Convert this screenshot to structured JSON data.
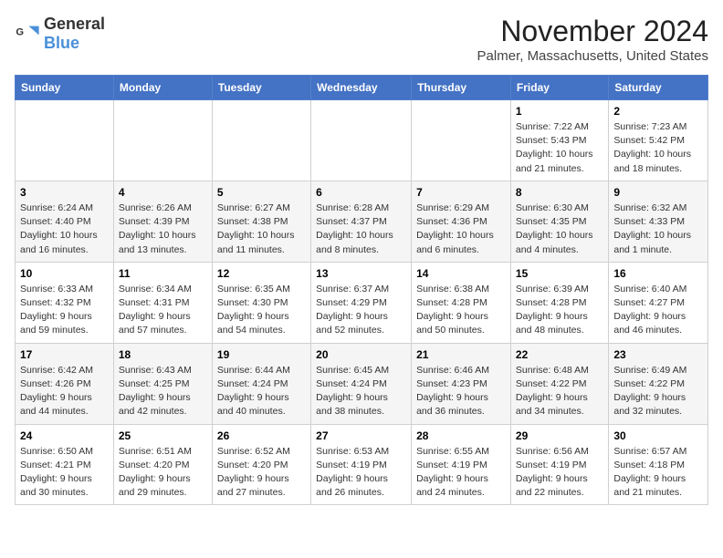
{
  "logo": {
    "general": "General",
    "blue": "Blue"
  },
  "title": "November 2024",
  "location": "Palmer, Massachusetts, United States",
  "days_of_week": [
    "Sunday",
    "Monday",
    "Tuesday",
    "Wednesday",
    "Thursday",
    "Friday",
    "Saturday"
  ],
  "weeks": [
    [
      {
        "day": "",
        "info": ""
      },
      {
        "day": "",
        "info": ""
      },
      {
        "day": "",
        "info": ""
      },
      {
        "day": "",
        "info": ""
      },
      {
        "day": "",
        "info": ""
      },
      {
        "day": "1",
        "info": "Sunrise: 7:22 AM\nSunset: 5:43 PM\nDaylight: 10 hours and 21 minutes."
      },
      {
        "day": "2",
        "info": "Sunrise: 7:23 AM\nSunset: 5:42 PM\nDaylight: 10 hours and 18 minutes."
      }
    ],
    [
      {
        "day": "3",
        "info": "Sunrise: 6:24 AM\nSunset: 4:40 PM\nDaylight: 10 hours and 16 minutes."
      },
      {
        "day": "4",
        "info": "Sunrise: 6:26 AM\nSunset: 4:39 PM\nDaylight: 10 hours and 13 minutes."
      },
      {
        "day": "5",
        "info": "Sunrise: 6:27 AM\nSunset: 4:38 PM\nDaylight: 10 hours and 11 minutes."
      },
      {
        "day": "6",
        "info": "Sunrise: 6:28 AM\nSunset: 4:37 PM\nDaylight: 10 hours and 8 minutes."
      },
      {
        "day": "7",
        "info": "Sunrise: 6:29 AM\nSunset: 4:36 PM\nDaylight: 10 hours and 6 minutes."
      },
      {
        "day": "8",
        "info": "Sunrise: 6:30 AM\nSunset: 4:35 PM\nDaylight: 10 hours and 4 minutes."
      },
      {
        "day": "9",
        "info": "Sunrise: 6:32 AM\nSunset: 4:33 PM\nDaylight: 10 hours and 1 minute."
      }
    ],
    [
      {
        "day": "10",
        "info": "Sunrise: 6:33 AM\nSunset: 4:32 PM\nDaylight: 9 hours and 59 minutes."
      },
      {
        "day": "11",
        "info": "Sunrise: 6:34 AM\nSunset: 4:31 PM\nDaylight: 9 hours and 57 minutes."
      },
      {
        "day": "12",
        "info": "Sunrise: 6:35 AM\nSunset: 4:30 PM\nDaylight: 9 hours and 54 minutes."
      },
      {
        "day": "13",
        "info": "Sunrise: 6:37 AM\nSunset: 4:29 PM\nDaylight: 9 hours and 52 minutes."
      },
      {
        "day": "14",
        "info": "Sunrise: 6:38 AM\nSunset: 4:28 PM\nDaylight: 9 hours and 50 minutes."
      },
      {
        "day": "15",
        "info": "Sunrise: 6:39 AM\nSunset: 4:28 PM\nDaylight: 9 hours and 48 minutes."
      },
      {
        "day": "16",
        "info": "Sunrise: 6:40 AM\nSunset: 4:27 PM\nDaylight: 9 hours and 46 minutes."
      }
    ],
    [
      {
        "day": "17",
        "info": "Sunrise: 6:42 AM\nSunset: 4:26 PM\nDaylight: 9 hours and 44 minutes."
      },
      {
        "day": "18",
        "info": "Sunrise: 6:43 AM\nSunset: 4:25 PM\nDaylight: 9 hours and 42 minutes."
      },
      {
        "day": "19",
        "info": "Sunrise: 6:44 AM\nSunset: 4:24 PM\nDaylight: 9 hours and 40 minutes."
      },
      {
        "day": "20",
        "info": "Sunrise: 6:45 AM\nSunset: 4:24 PM\nDaylight: 9 hours and 38 minutes."
      },
      {
        "day": "21",
        "info": "Sunrise: 6:46 AM\nSunset: 4:23 PM\nDaylight: 9 hours and 36 minutes."
      },
      {
        "day": "22",
        "info": "Sunrise: 6:48 AM\nSunset: 4:22 PM\nDaylight: 9 hours and 34 minutes."
      },
      {
        "day": "23",
        "info": "Sunrise: 6:49 AM\nSunset: 4:22 PM\nDaylight: 9 hours and 32 minutes."
      }
    ],
    [
      {
        "day": "24",
        "info": "Sunrise: 6:50 AM\nSunset: 4:21 PM\nDaylight: 9 hours and 30 minutes."
      },
      {
        "day": "25",
        "info": "Sunrise: 6:51 AM\nSunset: 4:20 PM\nDaylight: 9 hours and 29 minutes."
      },
      {
        "day": "26",
        "info": "Sunrise: 6:52 AM\nSunset: 4:20 PM\nDaylight: 9 hours and 27 minutes."
      },
      {
        "day": "27",
        "info": "Sunrise: 6:53 AM\nSunset: 4:19 PM\nDaylight: 9 hours and 26 minutes."
      },
      {
        "day": "28",
        "info": "Sunrise: 6:55 AM\nSunset: 4:19 PM\nDaylight: 9 hours and 24 minutes."
      },
      {
        "day": "29",
        "info": "Sunrise: 6:56 AM\nSunset: 4:19 PM\nDaylight: 9 hours and 22 minutes."
      },
      {
        "day": "30",
        "info": "Sunrise: 6:57 AM\nSunset: 4:18 PM\nDaylight: 9 hours and 21 minutes."
      }
    ]
  ]
}
